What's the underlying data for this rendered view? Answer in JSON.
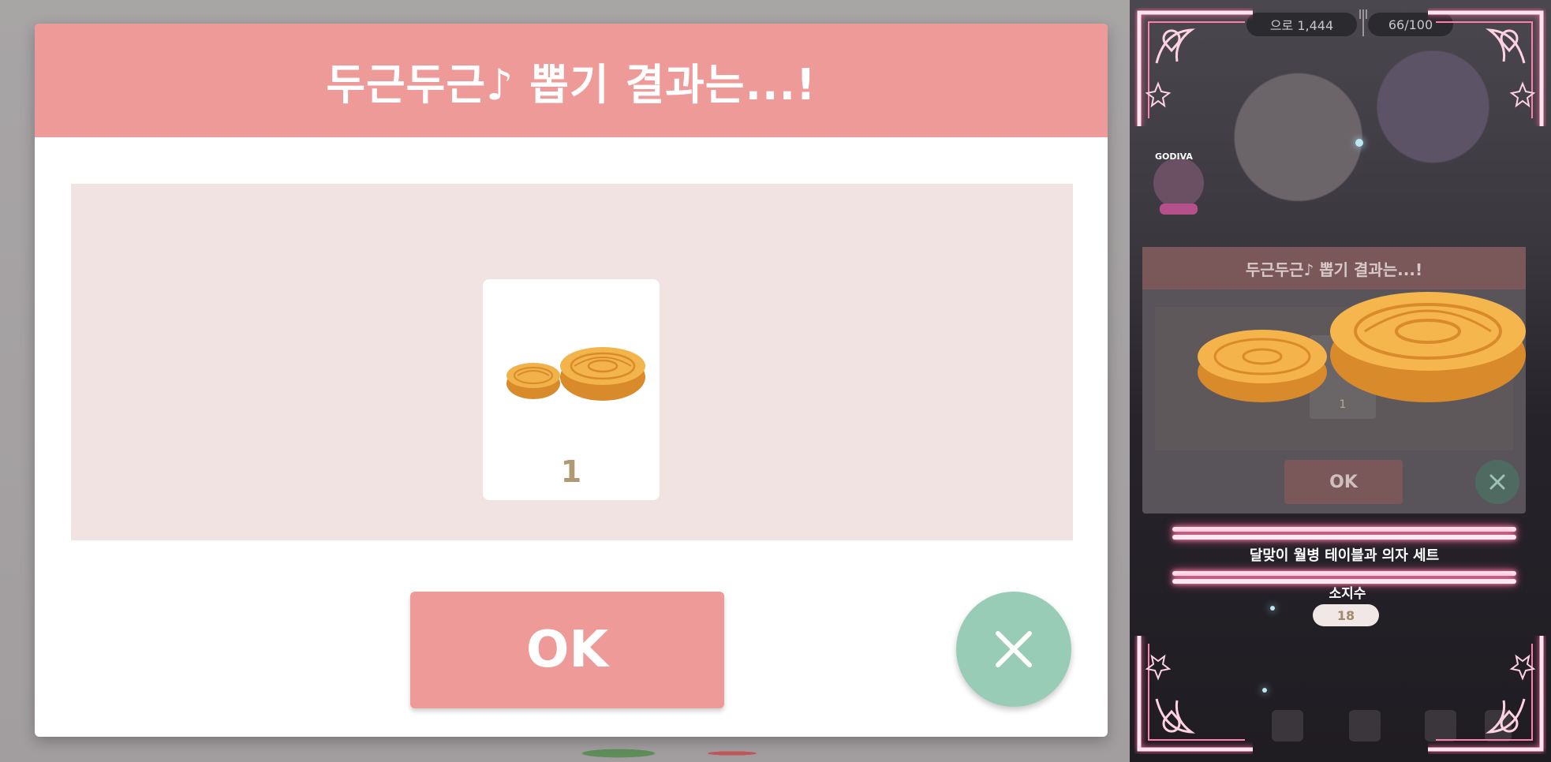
{
  "popup": {
    "title": "두근두근♪ 뽑기 결과는...!",
    "reward": {
      "icon": "mooncake-icon",
      "count": "1"
    },
    "ok_label": "OK",
    "close_icon": "close-icon"
  },
  "side_panel": {
    "hud": {
      "currency_text": "으로 1,444",
      "stamina_text": "66/100"
    },
    "badge_text": "GODIVA",
    "mini_popup": {
      "title": "두근두근♪ 뽑기 결과는...!",
      "count": "1",
      "ok_label": "OK"
    },
    "item_name": "달맞이 월병 테이블과 의자 세트",
    "owned_label": "소지수",
    "owned_count": "18"
  },
  "colors": {
    "popup_accent": "#ee9a99",
    "close_button": "#98ccb6",
    "reward_area": "#f2e3e3",
    "count_text": "#b09a74",
    "neon_pink": "#ff5f95"
  }
}
